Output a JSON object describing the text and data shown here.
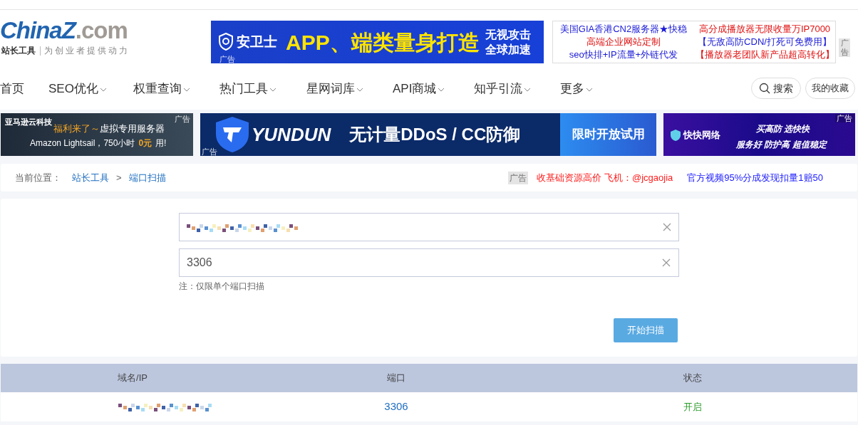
{
  "header": {
    "logo": [
      "China",
      "Z",
      ".com"
    ],
    "tagline_brand": "站长工具",
    "tagline": "为创业者提供动力",
    "top_ad": {
      "brand": "安卫士",
      "headline": "APP、端类量身打造",
      "side_lines": [
        "无视攻击",
        "全球加速"
      ],
      "badge": "广告"
    },
    "text_ads": [
      {
        "text": "美国GIA香港CN2服务器★快稳",
        "color": "#1a1ad6"
      },
      {
        "text": "高分成播放器无限收量万IP7000",
        "color": "#e01010"
      },
      {
        "text": "高端企业网站定制",
        "color": "#e01010"
      },
      {
        "text": "【无敌高防CDN/打死可免费用】",
        "color": "#1a1ad6"
      },
      {
        "text": "seo快排+IP流量+外链代发",
        "color": "#1a1ad6"
      },
      {
        "text": "【播放器老团队新产品超高转化】",
        "color": "#e01010"
      }
    ],
    "text_ads_badge": "广告"
  },
  "nav": {
    "items": [
      {
        "label": "首页",
        "dropdown": false
      },
      {
        "label": "SEO优化",
        "dropdown": true
      },
      {
        "label": "权重查询",
        "dropdown": true
      },
      {
        "label": "热门工具",
        "dropdown": true
      },
      {
        "label": "星网词库",
        "dropdown": true
      },
      {
        "label": "API商城",
        "dropdown": true
      },
      {
        "label": "知乎引流",
        "dropdown": true
      },
      {
        "label": "更多",
        "dropdown": true
      }
    ],
    "search": "搜索",
    "favorites": "我的收藏"
  },
  "banners": {
    "amazon": {
      "brand": "亚马逊云科技",
      "line1_highlight": "福利来了～",
      "line1": "虚拟专用服务器",
      "line2": "Amazon Lightsail，750小时",
      "line2_highlight": "0元",
      "line2_end": "用!",
      "badge": "广告"
    },
    "yundun": {
      "brand": "YUNDUN",
      "headline": "无计量DDoS / CC防御",
      "cta": "限时开放试用",
      "badge": "广告"
    },
    "kuaikuai": {
      "brand": "快快网络",
      "line1": "买高防 选快快",
      "line2": "服务好 防护高 超值稳定",
      "badge": "广告"
    }
  },
  "breadcrumb": {
    "label": "当前位置：",
    "items": [
      "站长工具",
      "端口扫描"
    ],
    "separator": ">",
    "ad_badge": "广告",
    "ads": [
      {
        "text": "收基础资源高价 飞机：@jcgaojia",
        "color": "#ff1a1a"
      },
      {
        "text": "官方视频95%分成发现扣量1赔50",
        "color": "#1a1aff"
      }
    ]
  },
  "form": {
    "port": "3306",
    "note": "注：仅限单个端口扫描",
    "submit": "开始扫描"
  },
  "table": {
    "columns": [
      "域名/IP",
      "端口",
      "状态"
    ],
    "rows": [
      {
        "port": "3306",
        "status": "开启"
      }
    ]
  }
}
